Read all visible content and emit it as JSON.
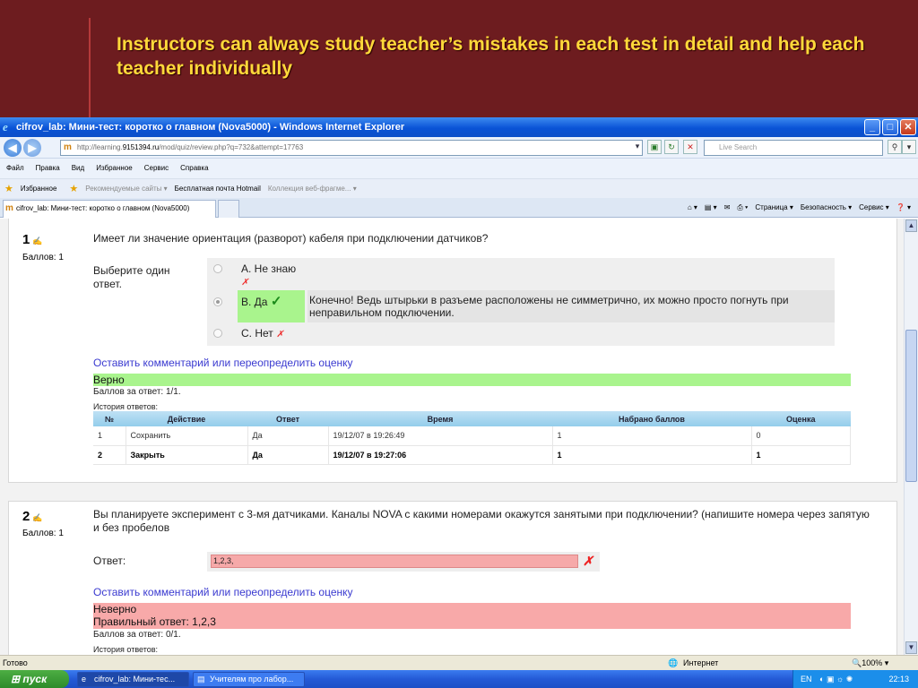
{
  "slide": {
    "title": "Instructors can always study teacher’s mistakes in each test in detail and help each teacher individually"
  },
  "window": {
    "title": "cifrov_lab: Мини-тест: коротко о главном (Nova5000) - Windows Internet Explorer",
    "buttons": {
      "min": "_",
      "max": "□",
      "close": "✕"
    }
  },
  "address": {
    "url_prefix": "http://learning.",
    "url_host": "9151394.ru",
    "url_path": "/mod/quiz/review.php?q=732&attempt=17763",
    "search_placeholder": "Live Search"
  },
  "menu": [
    "Файл",
    "Правка",
    "Вид",
    "Избранное",
    "Сервис",
    "Справка"
  ],
  "favorites": {
    "label": "Избранное",
    "items": [
      "Рекомендуемые сайты ▾",
      "Бесплатная почта Hotmail",
      "Коллекция веб-фрагме... ▾"
    ]
  },
  "tab": {
    "label": "cifrov_lab: Мини-тест: коротко о главном (Nova5000)"
  },
  "command_bar": [
    "Страница ▾",
    "Безопасность ▾",
    "Сервис ▾"
  ],
  "q1": {
    "number": "1",
    "marks": "Баллов: 1",
    "text": "Имеет ли значение ориентация (разворот) кабеля при подключении датчиков?",
    "choose_label": "Выберите один ответ.",
    "options": [
      {
        "label": "A. Не знаю",
        "mark": "✗"
      },
      {
        "label": "B. Да",
        "mark": "✓"
      },
      {
        "label": "C. Нет",
        "mark": "✗"
      }
    ],
    "feedback": "Конечно! Ведь штырьки в разъеме расположены не симметрично, их можно просто погнуть при неправильном подключении.",
    "comment_link": "Оставить комментарий или переопределить оценку",
    "grade": "Верно",
    "points": "Баллов за ответ: 1/1.",
    "history_title": "История ответов:",
    "history": {
      "headers": [
        "№",
        "Действие",
        "Ответ",
        "Время",
        "Набрано баллов",
        "Оценка"
      ],
      "rows": [
        [
          "1",
          "Сохранить",
          "Да",
          "19/12/07 в 19:26:49",
          "1",
          "0"
        ],
        [
          "2",
          "Закрыть",
          "Да",
          "19/12/07 в 19:27:06",
          "1",
          "1"
        ]
      ]
    }
  },
  "q2": {
    "number": "2",
    "marks": "Баллов: 1",
    "text": "Вы планируете эксперимент с 3-мя датчиками. Каналы NOVA с какими номерами окажутся занятыми при подключении? (напишите номера через запятую и без пробелов",
    "answer_label": "Ответ:",
    "answer_value": "1,2,3,",
    "answer_mark": "✗",
    "comment_link": "Оставить комментарий или переопределить оценку",
    "grade": "Неверно",
    "correct_answer": "Правильный ответ: 1,2,3",
    "points": "Баллов за ответ: 0/1.",
    "history_title": "История ответов:"
  },
  "status": {
    "left": "Готово",
    "zone": "Интернет",
    "zoom": "100%"
  },
  "taskbar": {
    "start": "пуск",
    "tasks": [
      "cifrov_lab: Мини-тес...",
      "Учителям про лабор..."
    ],
    "lang": "EN",
    "clock": "22:13"
  }
}
